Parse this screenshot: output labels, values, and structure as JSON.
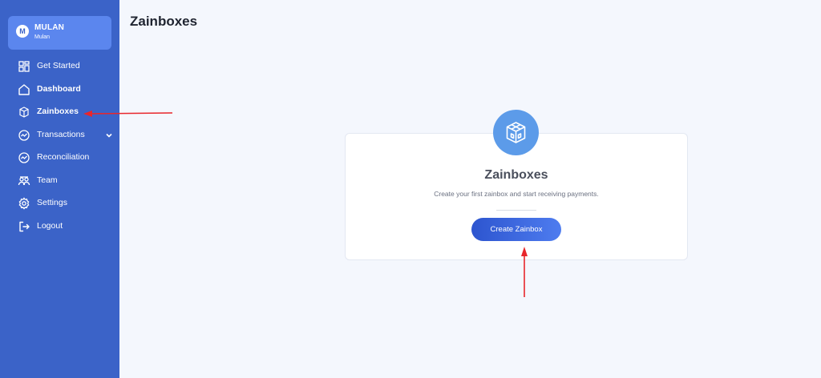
{
  "sidebar": {
    "profile": {
      "initial": "M",
      "name": "MULAN",
      "subtitle": "Mulan"
    },
    "items": [
      {
        "label": "Get Started",
        "icon": "grid-icon"
      },
      {
        "label": "Dashboard",
        "icon": "home-icon"
      },
      {
        "label": "Zainboxes",
        "icon": "box-icon"
      },
      {
        "label": "Transactions",
        "icon": "transactions-icon",
        "expandable": true
      },
      {
        "label": "Reconciliation",
        "icon": "reconciliation-icon"
      },
      {
        "label": "Team",
        "icon": "team-icon"
      },
      {
        "label": "Settings",
        "icon": "gear-icon"
      },
      {
        "label": "Logout",
        "icon": "logout-icon"
      }
    ]
  },
  "main": {
    "title": "Zainboxes",
    "empty_state": {
      "icon": "box-icon",
      "title": "Zainboxes",
      "description": "Create your first zainbox and start receiving payments.",
      "button_label": "Create Zainbox"
    }
  },
  "colors": {
    "sidebar_bg": "#3b63c8",
    "profile_bg": "#5b86ee",
    "page_bg": "#f4f7fd",
    "icon_circle": "#5c9be9",
    "button": "#2d55cf",
    "annotation_arrow": "#e8262b"
  }
}
